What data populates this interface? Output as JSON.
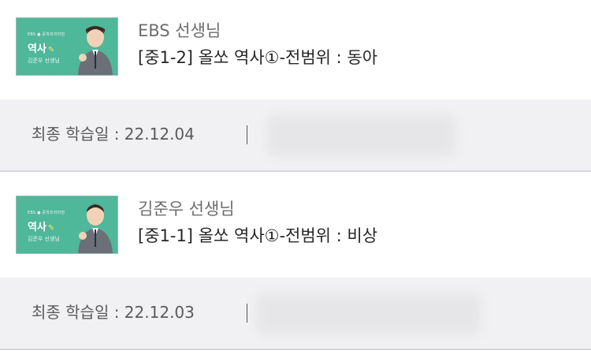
{
  "courses": [
    {
      "thumbnail": {
        "logo_text": "EBS ● 중학프리미엄",
        "subject": "역사",
        "teacher": "김준우 선생님",
        "accent": "#4fb79a"
      },
      "teacher_name": "EBS 선생님",
      "title": "[중1-2] 올쏘 역사①-전범위 : 동아",
      "last_study_label": "최종 학습일 : 22.12.04",
      "separator": "|"
    },
    {
      "thumbnail": {
        "logo_text": "EBS ● 중학프리미엄",
        "subject": "역사",
        "teacher": "김준우 선생님",
        "accent": "#4fb79a"
      },
      "teacher_name": "김준우 선생님",
      "title": "[중1-1] 올쏘 역사①-전범위 : 비상",
      "last_study_label": "최종 학습일 : 22.12.03",
      "separator": "|"
    }
  ],
  "colors": {
    "info_background": "#f1f1f3",
    "thumbnail_green": "#4fb79a"
  }
}
